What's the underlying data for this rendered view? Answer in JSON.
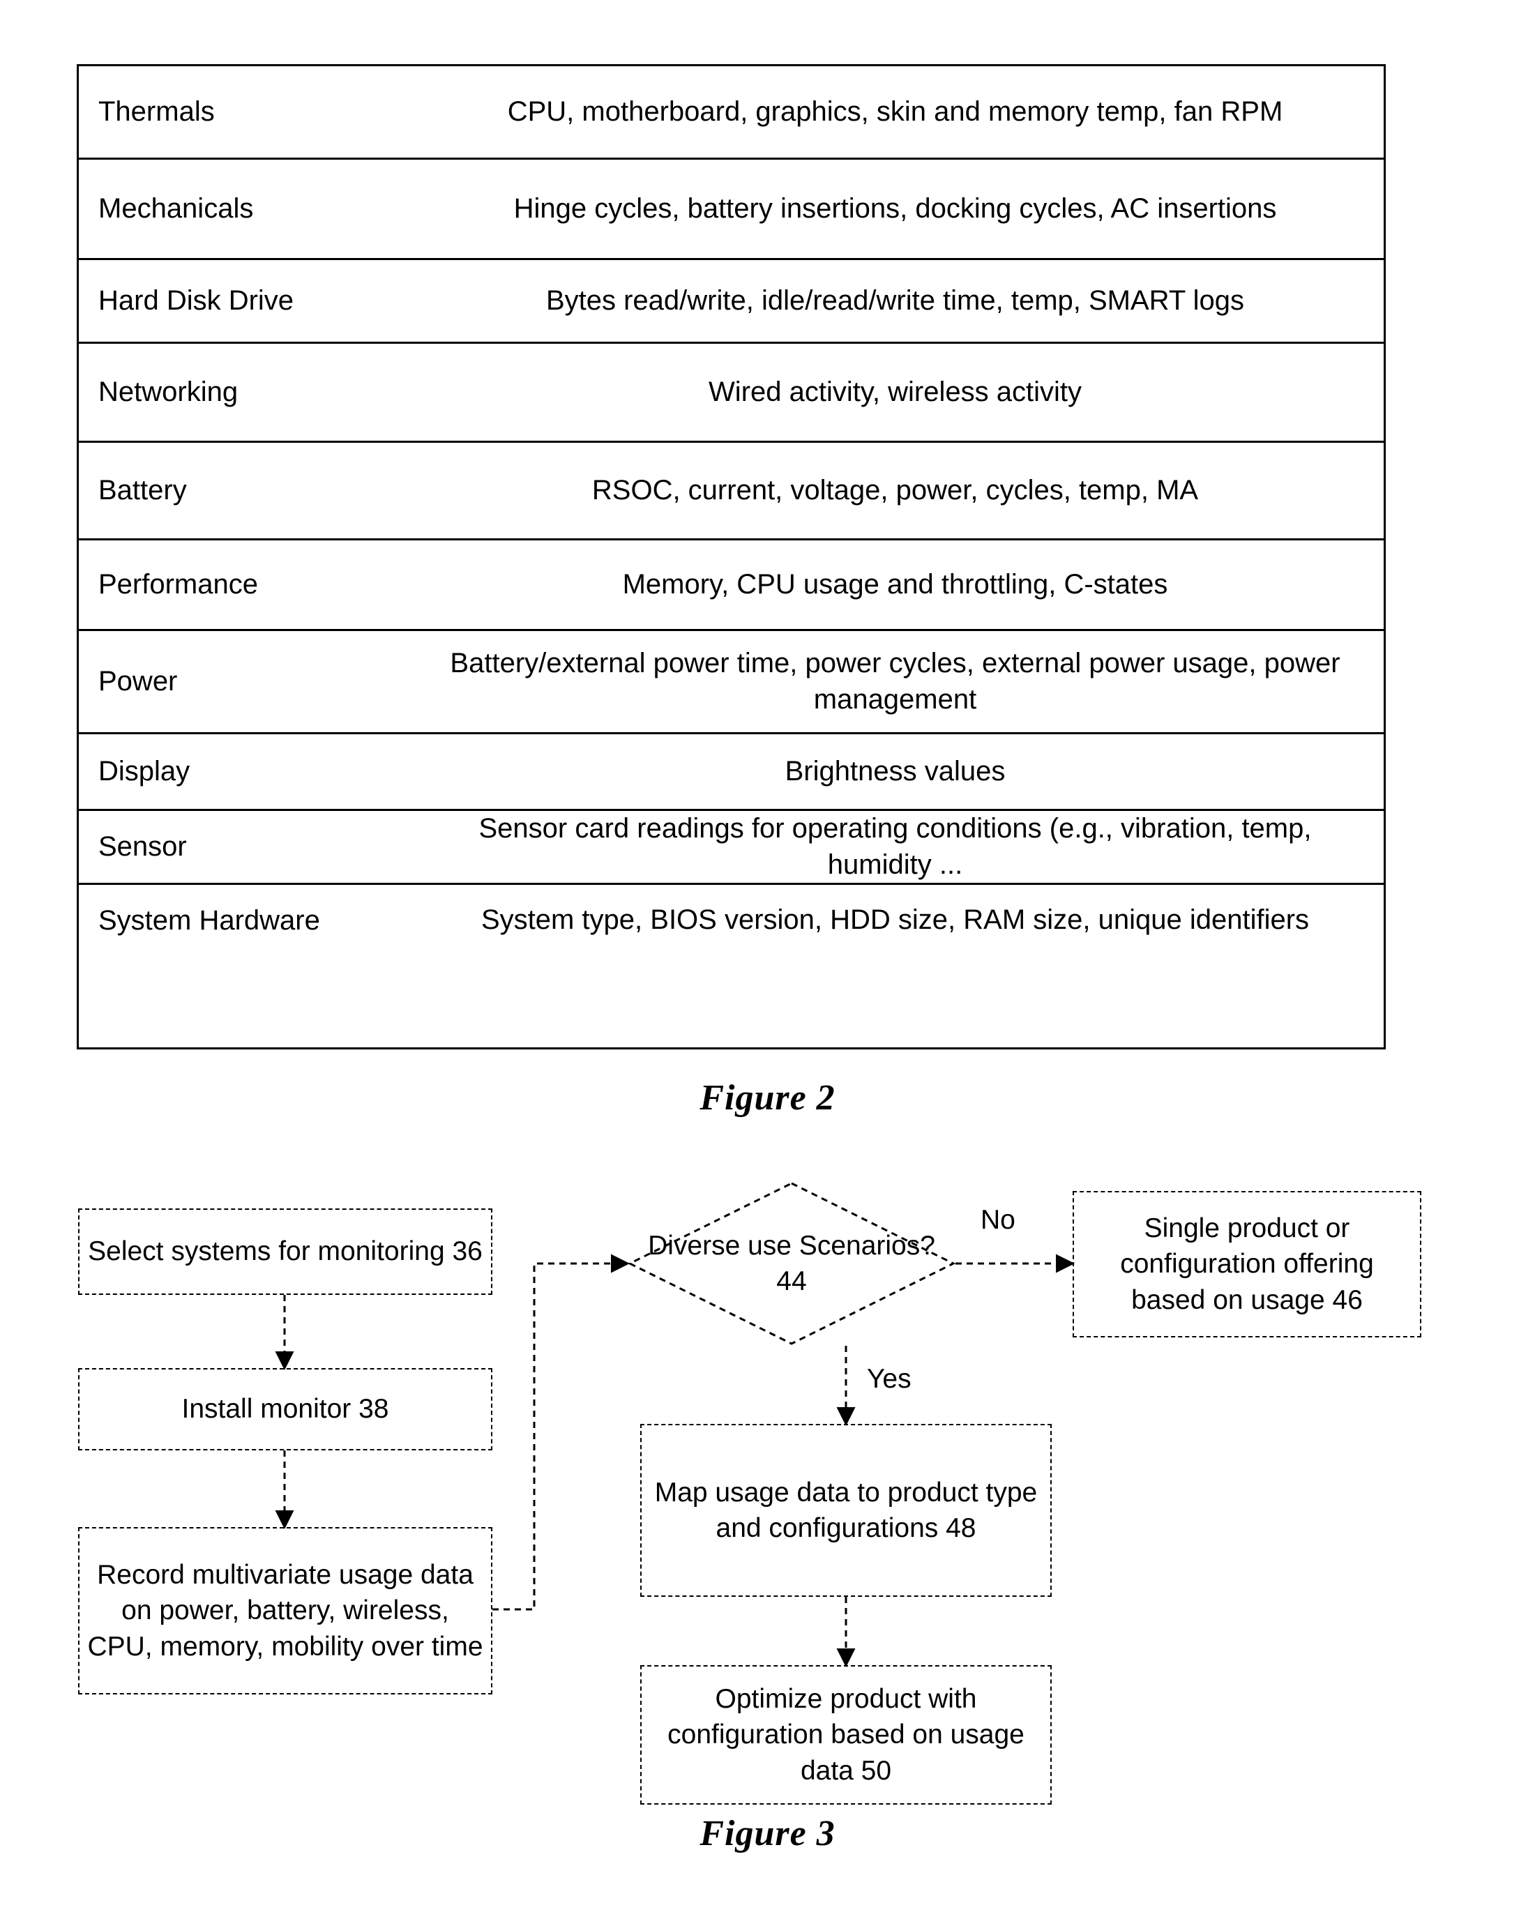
{
  "figure2": {
    "caption": "Figure 2",
    "rows": [
      {
        "category": "Thermals",
        "detail": "CPU, motherboard, graphics, skin and memory temp, fan RPM"
      },
      {
        "category": "Mechanicals",
        "detail": "Hinge cycles, battery insertions, docking cycles, AC insertions"
      },
      {
        "category": "Hard Disk Drive",
        "detail": "Bytes read/write, idle/read/write time, temp, SMART logs"
      },
      {
        "category": "Networking",
        "detail": "Wired activity, wireless activity"
      },
      {
        "category": "Battery",
        "detail": "RSOC, current, voltage, power, cycles, temp, MA"
      },
      {
        "category": "Performance",
        "detail": "Memory, CPU usage and throttling, C-states"
      },
      {
        "category": "Power",
        "detail": "Battery/external power time, power cycles, external power usage, power management"
      },
      {
        "category": "Display",
        "detail": "Brightness values"
      },
      {
        "category": "Sensor",
        "detail": "Sensor card readings for operating conditions (e.g., vibration, temp, humidity ..."
      },
      {
        "category": "System Hardware",
        "detail": "System type, BIOS version, HDD size, RAM size, unique identifiers"
      }
    ]
  },
  "figure3": {
    "caption": "Figure 3",
    "nodes": {
      "select_systems": "Select systems for monitoring 36",
      "install_monitor": "Install monitor 38",
      "record_usage": "Record multivariate usage data on power, battery, wireless, CPU, memory, mobility over time",
      "decision": "Diverse use Scenarios? 44",
      "single_product": "Single product or configuration offering based on usage 46",
      "map_usage": "Map usage data to product type and configurations 48",
      "optimize_product": "Optimize product with configuration based on usage data 50"
    },
    "edge_labels": {
      "no": "No",
      "yes": "Yes"
    }
  }
}
